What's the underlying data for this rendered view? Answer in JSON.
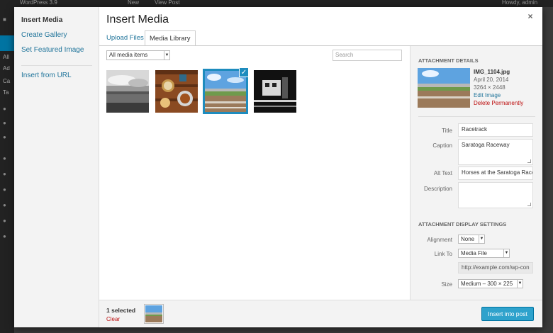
{
  "wp_admin": {
    "site_title": "WordPress 3.9",
    "new_label": "New",
    "view_post": "View Post",
    "greeting": "Howdy, admin",
    "sidebar_letters": [
      "All",
      "Ad",
      "Ca",
      "Ta"
    ]
  },
  "modal": {
    "title": "Insert Media",
    "close_label": "×",
    "menu": {
      "insert_media": "Insert Media",
      "create_gallery": "Create Gallery",
      "set_featured": "Set Featured Image",
      "insert_url": "Insert from URL"
    },
    "tabs": {
      "upload": "Upload Files",
      "library": "Media Library"
    },
    "filter": {
      "selected": "All media items"
    },
    "search": {
      "placeholder": "Search"
    },
    "check_mark": "✓"
  },
  "attachment": {
    "section_title": "ATTACHMENT DETAILS",
    "filename": "IMG_1104.jpg",
    "date": "April 20, 2014",
    "dimensions": "3264 × 2448",
    "edit_label": "Edit Image",
    "delete_label": "Delete Permanently",
    "fields": {
      "title_label": "Title",
      "title_value": "Racetrack",
      "caption_label": "Caption",
      "caption_value": "Saratoga Raceway",
      "alt_label": "Alt Text",
      "alt_value": "Horses at the Saratoga Race",
      "description_label": "Description",
      "description_value": ""
    }
  },
  "display_settings": {
    "section_title": "ATTACHMENT DISPLAY SETTINGS",
    "alignment_label": "Alignment",
    "alignment_value": "None",
    "link_label": "Link To",
    "link_value": "Media File",
    "url_value": "http://example.com/wp-con",
    "size_label": "Size",
    "size_value": "Medium – 300 × 225"
  },
  "toolbar": {
    "selected_count": "1 selected",
    "clear_label": "Clear",
    "insert_label": "Insert into post"
  },
  "colors": {
    "accent": "#1e8cbe",
    "button": "#2ea2cc",
    "link": "#21759b",
    "danger": "#bc0b0b"
  }
}
